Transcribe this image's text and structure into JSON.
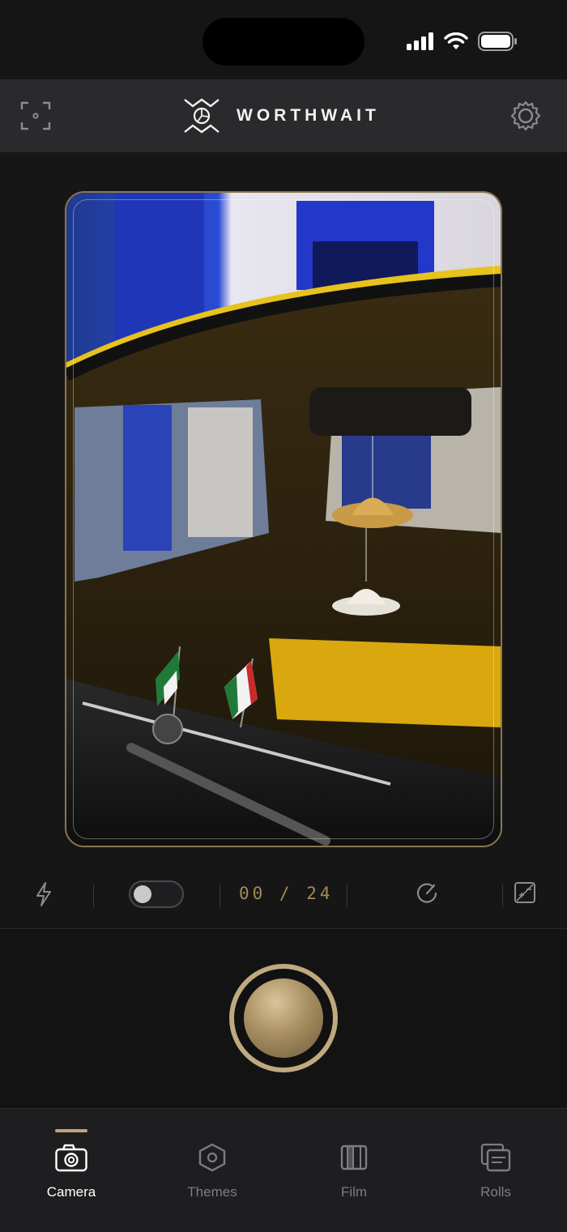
{
  "status_bar": {
    "signal_icon": "signal-bars-icon",
    "wifi_icon": "wifi-icon",
    "battery_icon": "battery-icon"
  },
  "header": {
    "brand_name": "WORTHWAIT",
    "left_icon": "focus-frame-icon",
    "right_icon": "gear-icon"
  },
  "viewfinder": {
    "subject": "photo"
  },
  "controls": {
    "flash_icon": "lightning-icon",
    "toggle_on": false,
    "shot_counter": "00 / 24",
    "timer_icon": "timer-dial-icon",
    "exposure_icon": "exposure-compensation-icon"
  },
  "tabs": [
    {
      "label": "Camera",
      "icon": "camera-icon",
      "active": true
    },
    {
      "label": "Themes",
      "icon": "hexagon-icon",
      "active": false
    },
    {
      "label": "Film",
      "icon": "film-icon",
      "active": false
    },
    {
      "label": "Rolls",
      "icon": "rolls-stack-icon",
      "active": false
    }
  ],
  "colors": {
    "accent": "#bfa57a",
    "background": "#161617",
    "header": "#2a2a2d",
    "counter": "#a48a55"
  }
}
